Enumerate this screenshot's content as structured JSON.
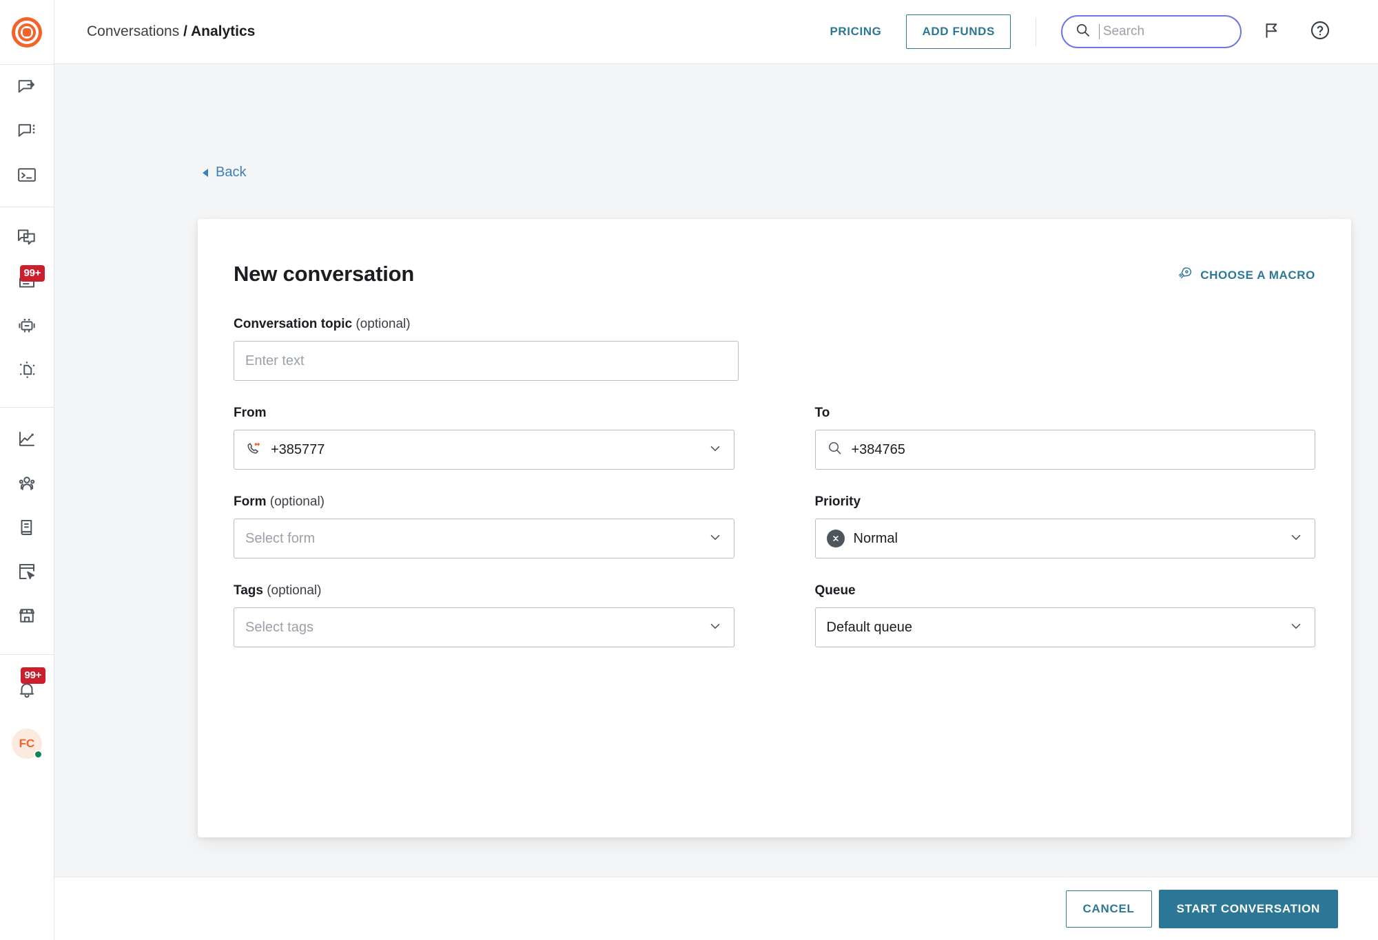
{
  "brand": {
    "logo_icon": "target-logo-icon",
    "accent_orange": "#f4632a",
    "accent_teal": "#2d7796",
    "focus_purple": "#6e76e5",
    "badge_red": "#cc1f2d"
  },
  "header": {
    "breadcrumb_parent": "Conversations",
    "breadcrumb_separator": "/",
    "breadcrumb_current": "Analytics",
    "pricing_label": "PRICING",
    "add_funds_label": "ADD FUNDS",
    "search": {
      "value": "",
      "placeholder": "Search",
      "icon": "search-icon",
      "focused": true
    },
    "announcements_icon": "megaphone-icon",
    "help_icon": "help-circle-icon"
  },
  "sidebar": {
    "groups": [
      {
        "items": [
          {
            "name": "sidebar-item-outbound",
            "icon": "chat-arrow-out-icon",
            "badge": null
          },
          {
            "name": "sidebar-item-conversations",
            "icon": "chat-dots-icon",
            "badge": null
          },
          {
            "name": "sidebar-item-console",
            "icon": "terminal-icon",
            "badge": null
          }
        ]
      },
      {
        "items": [
          {
            "name": "sidebar-item-multichannel",
            "icon": "chat-stack-icon",
            "badge": null
          },
          {
            "name": "sidebar-item-inbox",
            "icon": "inbox-tray-icon",
            "badge": "99+"
          },
          {
            "name": "sidebar-item-bots",
            "icon": "robot-icon",
            "badge": null
          },
          {
            "name": "sidebar-item-flow",
            "icon": "sparkle-page-icon",
            "badge": null
          }
        ]
      },
      {
        "items": [
          {
            "name": "sidebar-item-analytics",
            "icon": "line-chart-icon",
            "badge": null
          },
          {
            "name": "sidebar-item-people",
            "icon": "people-group-icon",
            "badge": null
          },
          {
            "name": "sidebar-item-docs",
            "icon": "book-icon",
            "badge": null
          },
          {
            "name": "sidebar-item-apps",
            "icon": "window-cursor-icon",
            "badge": null
          },
          {
            "name": "sidebar-item-marketplace",
            "icon": "storefront-icon",
            "badge": null
          }
        ]
      }
    ],
    "notifications": {
      "icon": "bell-icon",
      "badge": "99+"
    },
    "account": {
      "initials": "FC",
      "presence": "online"
    }
  },
  "page": {
    "back_label": "Back",
    "card_title": "New conversation",
    "macro_label": "CHOOSE A MACRO",
    "macro_icon": "rocket-icon"
  },
  "form": {
    "topic": {
      "label": "Conversation topic",
      "optional": "(optional)",
      "value": "",
      "placeholder": "Enter text"
    },
    "from": {
      "label": "From",
      "value": "+385777",
      "icon": "phone-two-way-icon",
      "chevron": "chevron-down-icon"
    },
    "to": {
      "label": "To",
      "value": "+384765",
      "icon": "search-icon"
    },
    "form_select": {
      "label": "Form",
      "optional": "(optional)",
      "value": "",
      "placeholder": "Select form",
      "chevron": "chevron-down-icon"
    },
    "priority": {
      "label": "Priority",
      "value": "Normal",
      "icon": "priority-normal-icon",
      "chevron": "chevron-down-icon"
    },
    "tags": {
      "label": "Tags",
      "optional": "(optional)",
      "value": "",
      "placeholder": "Select tags",
      "chevron": "chevron-down-icon"
    },
    "queue": {
      "label": "Queue",
      "value": "Default queue",
      "chevron": "chevron-down-icon"
    }
  },
  "footer": {
    "cancel_label": "CANCEL",
    "submit_label": "START CONVERSATION"
  }
}
